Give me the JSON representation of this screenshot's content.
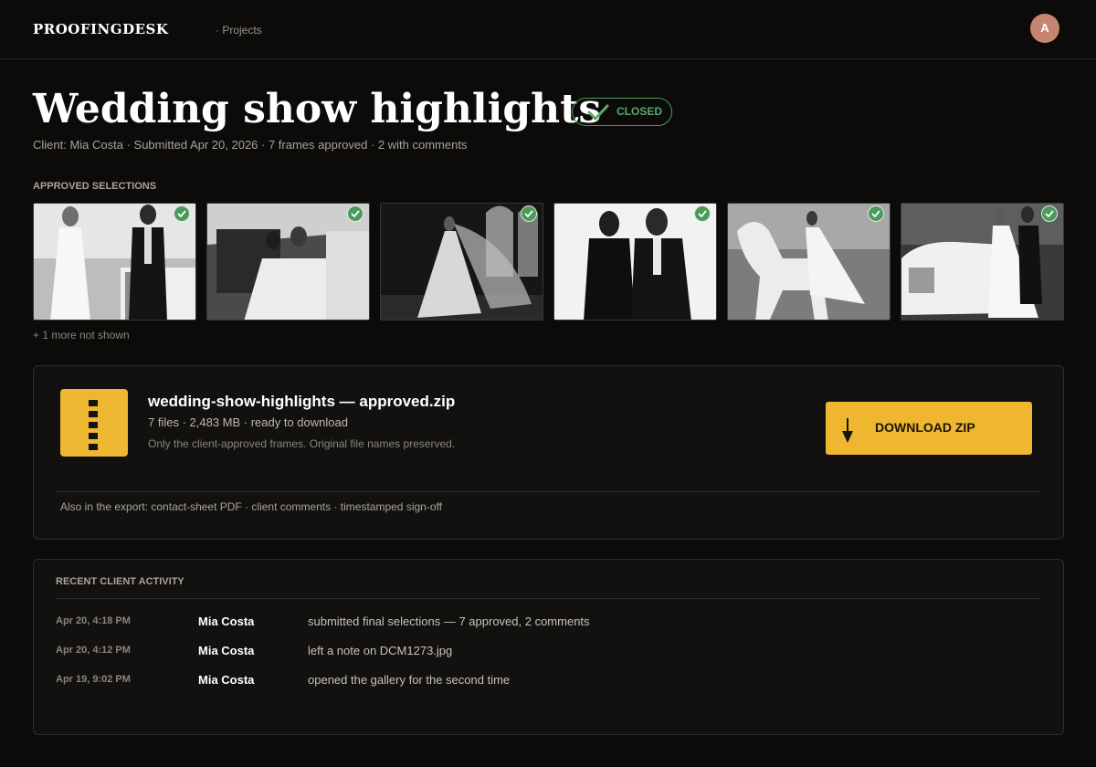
{
  "header": {
    "brand": "PROOFINGDESK",
    "breadcrumb": "· Projects",
    "avatar_initial": "A"
  },
  "project": {
    "title": "Wedding show highlights",
    "status": "CLOSED",
    "meta": "Client: Mia Costa · Submitted Apr 20, 2026 · 7 frames approved · 2 with comments"
  },
  "selections": {
    "label": "APPROVED SELECTIONS",
    "thumbnails": [
      {
        "subject": "bride-and-groom-by-car",
        "approved": true
      },
      {
        "subject": "couple-in-car-backseat",
        "approved": true
      },
      {
        "subject": "bride-with-long-veil",
        "approved": true
      },
      {
        "subject": "couple-black-outfits",
        "approved": true
      },
      {
        "subject": "bride-with-white-horse",
        "approved": true
      },
      {
        "subject": "couple-with-rolls-royce",
        "approved": true
      }
    ],
    "more_text": "+ 1 more not shown"
  },
  "export": {
    "file_name": "wedding-show-highlights — approved.zip",
    "details": "7 files · 2,483 MB · ready to download",
    "note": "Only the client-approved frames. Original file names preserved.",
    "download_label": "DOWNLOAD ZIP",
    "also": "Also in the export: contact-sheet PDF · client comments · timestamped sign-off",
    "icon": "zip-file-icon"
  },
  "activity": {
    "label": "RECENT CLIENT ACTIVITY",
    "rows": [
      {
        "time": "Apr 20, 4:18 PM",
        "name": "Mia Costa",
        "action": "submitted final selections — 7 approved, 2 comments"
      },
      {
        "time": "Apr 20, 4:12 PM",
        "name": "Mia Costa",
        "action": "left a note on DCM1273.jpg"
      },
      {
        "time": "Apr 19, 9:02 PM",
        "name": "Mia Costa",
        "action": "opened the gallery for the second time"
      }
    ]
  },
  "colors": {
    "background": "#0c0b0a",
    "accent": "#efb730",
    "approved_green": "#4b9a5a",
    "avatar": "#c58570"
  }
}
